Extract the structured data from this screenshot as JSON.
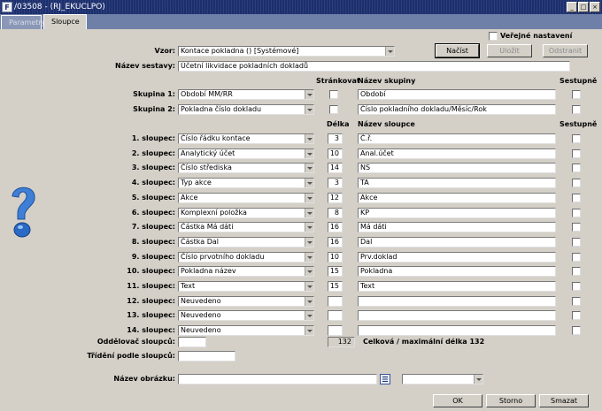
{
  "window": {
    "title": "/03508 - (RJ_EKUCLPO)",
    "app_icon": "F"
  },
  "tabs": [
    {
      "label": "Parametry"
    },
    {
      "label": "Sloupce"
    }
  ],
  "header": {
    "vzor_label": "Vzor:",
    "vzor_value": "Kontace pokladna  ()  [Systémové]",
    "public_label": "Veřejné nastavení",
    "load_button": "Načíst",
    "save_button": "Uložit",
    "remove_button": "Odstranit",
    "set_name_label": "Název sestavy:",
    "set_name_value": "Účetní likvidace pokladních dokladů"
  },
  "groups": {
    "col_strankovat": "Stránkovat",
    "col_group_name": "Název skupiny",
    "col_sestupne": "Sestupně",
    "rows": [
      {
        "label": "Skupina 1:",
        "value": "Období MM/RR",
        "name": "Období"
      },
      {
        "label": "Skupina 2:",
        "value": "Pokladna číslo dokladu",
        "name": "Číslo pokladního dokladu/Měsíc/Rok"
      }
    ]
  },
  "columns": {
    "col_delka": "Délka",
    "col_column_name": "Název sloupce",
    "col_sestupne": "Sestupně",
    "rows": [
      {
        "label": "1. sloupec:",
        "value": "Číslo řádku kontace",
        "length": "3",
        "name": "Č.ř."
      },
      {
        "label": "2. sloupec:",
        "value": "Analytický účet",
        "length": "10",
        "name": "Anal.účet"
      },
      {
        "label": "3. sloupec:",
        "value": "Číslo střediska",
        "length": "14",
        "name": "NS"
      },
      {
        "label": "4. sloupec:",
        "value": "Typ akce",
        "length": "3",
        "name": "TA"
      },
      {
        "label": "5. sloupec:",
        "value": "Akce",
        "length": "12",
        "name": "Akce"
      },
      {
        "label": "6. sloupec:",
        "value": "Komplexní položka",
        "length": "8",
        "name": "KP"
      },
      {
        "label": "7. sloupec:",
        "value": "Částka Má dáti",
        "length": "16",
        "name": "Má dáti"
      },
      {
        "label": "8. sloupec:",
        "value": "Částka Dal",
        "length": "16",
        "name": "Dal"
      },
      {
        "label": "9. sloupec:",
        "value": "Číslo prvotního dokladu",
        "length": "10",
        "name": "Prv.doklad"
      },
      {
        "label": "10. sloupec:",
        "value": "Pokladna název",
        "length": "15",
        "name": "Pokladna"
      },
      {
        "label": "11. sloupec:",
        "value": "Text",
        "length": "15",
        "name": "Text"
      },
      {
        "label": "12. sloupec:",
        "value": "Neuvedeno",
        "length": "",
        "name": ""
      },
      {
        "label": "13. sloupec:",
        "value": "Neuvedeno",
        "length": "",
        "name": ""
      },
      {
        "label": "14. sloupec:",
        "value": "Neuvedeno",
        "length": "",
        "name": ""
      }
    ]
  },
  "footer": {
    "separator_label": "Oddělovač sloupců:",
    "separator_value": "",
    "total_length": "132",
    "total_label": "Celková / maximální délka 132",
    "sort_label": "Třídění podle sloupců:",
    "sort_value": "",
    "image_label": "Název obrázku:",
    "image_value": "",
    "image_combo_value": "",
    "ok_button": "OK",
    "cancel_button": "Storno",
    "delete_button": "Smazat"
  },
  "colors": {
    "titlebar": "#1c2f6e",
    "tabstrip": "#6f80a8",
    "face": "#d4d0c8"
  },
  "icons": [
    "help-question-icon",
    "app-icon",
    "list-icon"
  ]
}
